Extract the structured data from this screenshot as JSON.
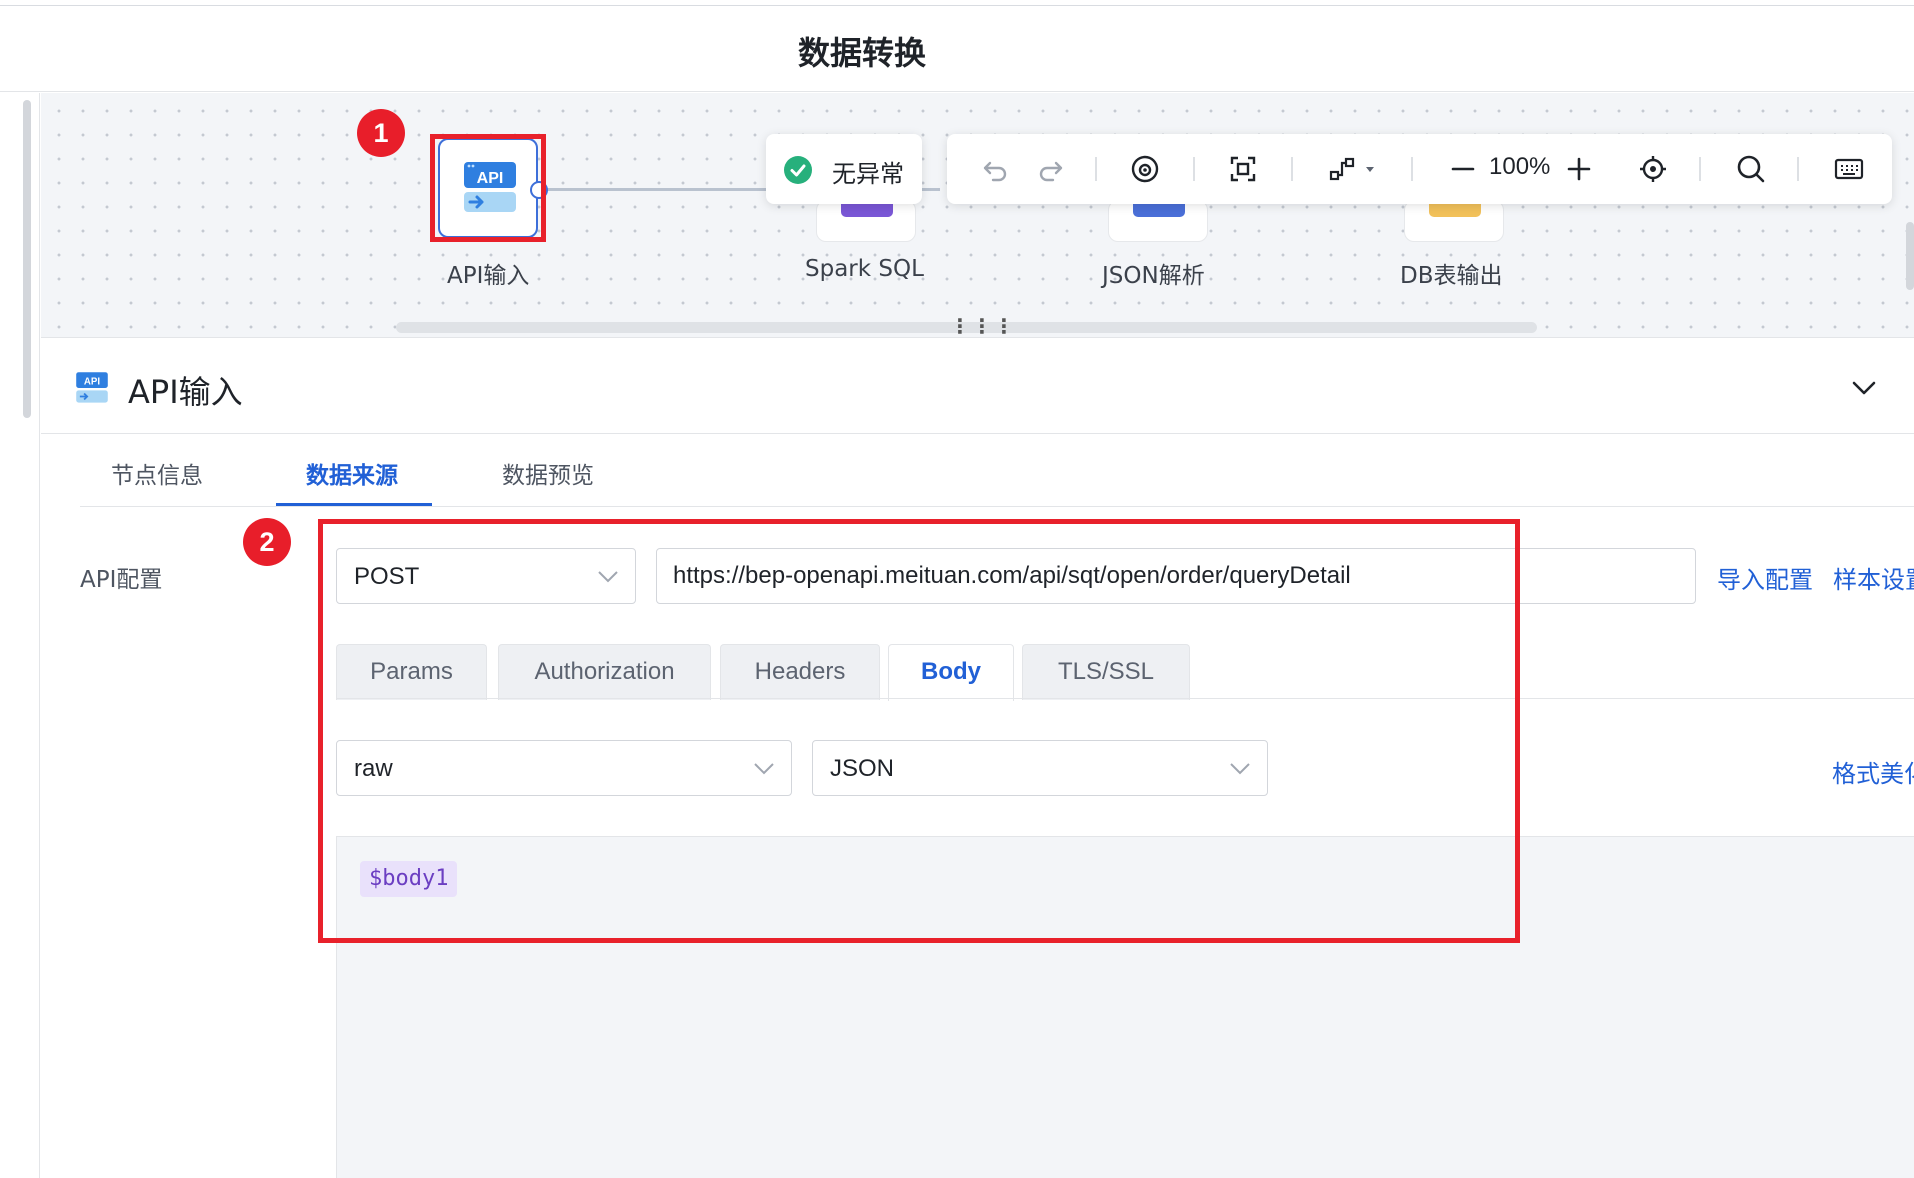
{
  "header": {
    "title": "数据转换"
  },
  "canvas": {
    "nodes": [
      {
        "label": "API输入",
        "icon": "api-input-icon",
        "selected": true
      },
      {
        "label": "Spark SQL",
        "icon": "spark-sql-icon"
      },
      {
        "label": "JSON解析",
        "icon": "json-parse-icon"
      },
      {
        "label": "DB表输出",
        "icon": "db-output-icon"
      }
    ],
    "status": {
      "text": "无异常",
      "color": "#27b07c"
    },
    "toolbar": {
      "zoom": "100%"
    },
    "markers": [
      "1",
      "2"
    ]
  },
  "panel": {
    "title": "API输入",
    "tabs": [
      "节点信息",
      "数据来源",
      "数据预览"
    ],
    "active_tab": "数据来源",
    "api_config": {
      "label": "API配置",
      "method": "POST",
      "url": "https://bep-openapi.meituan.com/api/sqt/open/order/queryDetail",
      "links": [
        "导入配置",
        "样本设置"
      ],
      "sub_tabs": [
        "Params",
        "Authorization",
        "Headers",
        "Body",
        "TLS/SSL"
      ],
      "active_sub_tab": "Body",
      "body_mode": "raw",
      "body_format": "JSON",
      "format_link": "格式美化",
      "body_token": "$body1"
    }
  },
  "colors": {
    "accent": "#2160d6",
    "highlight": "#e8212b",
    "token_bg": "#e9e1fb"
  }
}
